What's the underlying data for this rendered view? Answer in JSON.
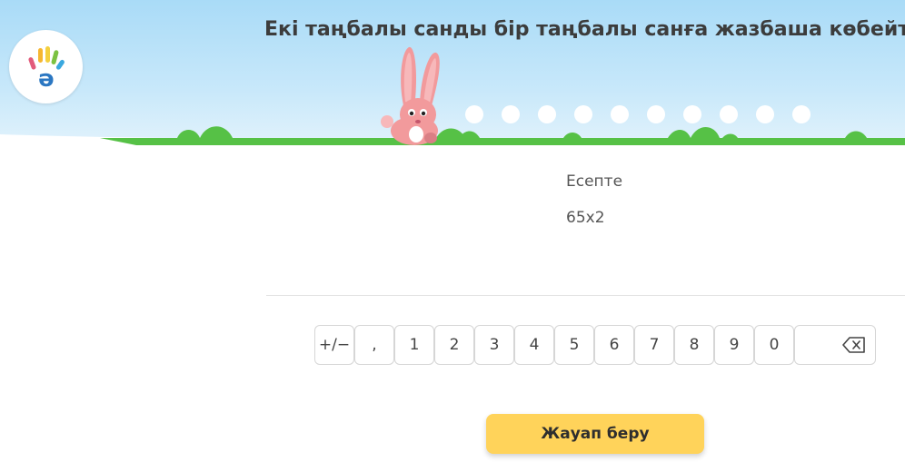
{
  "header": {
    "title": "Екі таңбалы санды бір таңбалы санға жазбаша көбейту",
    "logo_icon": "hand-logo-icon",
    "progress_dots": 10
  },
  "question": {
    "label": "Есепте",
    "expression": "65x2"
  },
  "keypad": {
    "sign_label": "+/−",
    "comma_label": ",",
    "digits": [
      "1",
      "2",
      "3",
      "4",
      "5",
      "6",
      "7",
      "8",
      "9",
      "0"
    ],
    "backspace_icon": "backspace-icon"
  },
  "submit": {
    "label": "Жауап беру"
  },
  "colors": {
    "sky": "#a9dbf7",
    "grass": "#5cc44a",
    "submit": "#ffd35a",
    "bunny": "#f29a9c"
  }
}
